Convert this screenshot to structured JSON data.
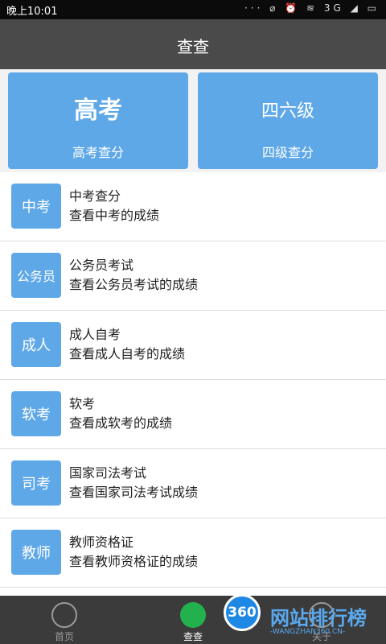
{
  "status_bar": {
    "time": "晚上10:01",
    "icons": "··· ⌀ ⏰ ≋ 3G ◢ ▭"
  },
  "header": {
    "title": "查查"
  },
  "top_cards": [
    {
      "logo": "高考",
      "label": "高考查分"
    },
    {
      "logo": "四六级",
      "label": "四级查分"
    }
  ],
  "list": [
    {
      "icon": "中考",
      "title": "中考查分",
      "subtitle": "查看中考的成绩"
    },
    {
      "icon": "公务员",
      "title": "公务员考试",
      "subtitle": "查看公务员考试的成绩"
    },
    {
      "icon": "成人",
      "title": "成人自考",
      "subtitle": "查看成人自考的成绩"
    },
    {
      "icon": "软考",
      "title": "软考",
      "subtitle": "查看成软考的成绩"
    },
    {
      "icon": "司考",
      "title": "国家司法考试",
      "subtitle": "查看国家司法考试成绩"
    },
    {
      "icon": "教师",
      "title": "教师资格证",
      "subtitle": "查看教师资格证的成绩"
    }
  ],
  "bottom_nav": [
    {
      "label": "首页",
      "active": false
    },
    {
      "label": "查查",
      "active": true
    },
    {
      "label": "关于",
      "active": false
    }
  ],
  "watermark": {
    "logo": "360",
    "text": "网站排行榜",
    "url": "-WANGZHAN360.CN-"
  },
  "colors": {
    "accent": "#5fa8e8",
    "header_bg": "#4a4a4a",
    "nav_bg": "#3b3b3b",
    "nav_active": "#22b14c"
  }
}
